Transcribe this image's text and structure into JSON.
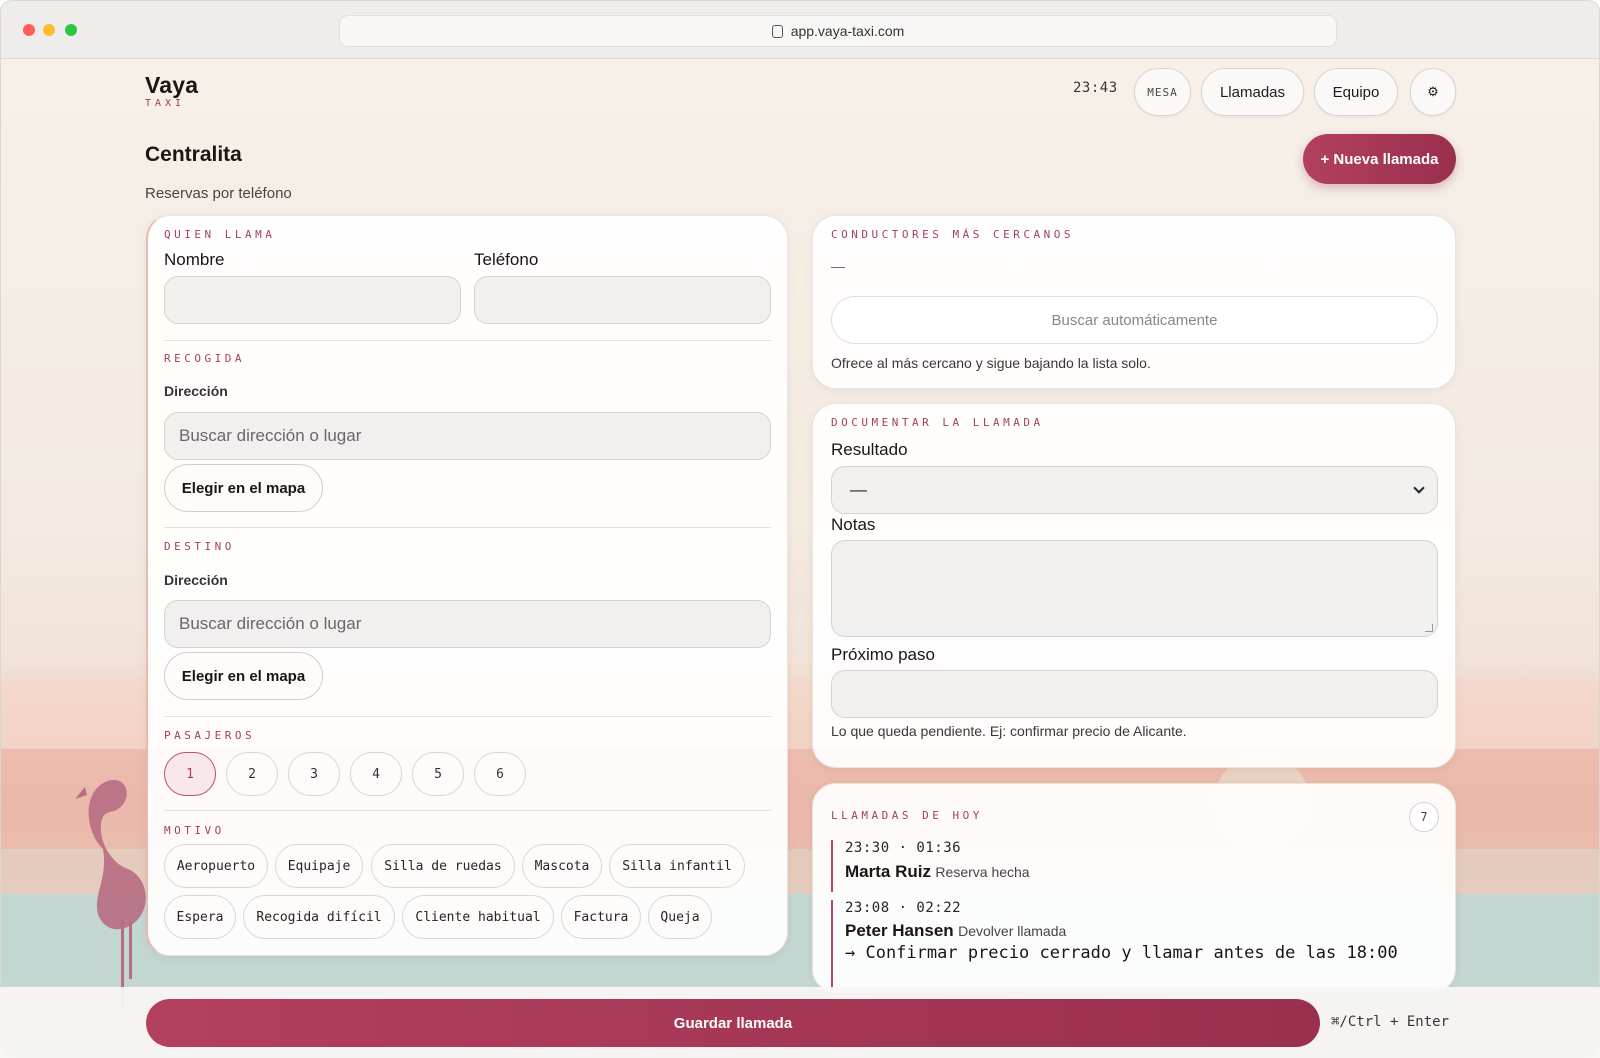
{
  "browser": {
    "url": "app.vaya-taxi.com"
  },
  "header": {
    "logo": "Vaya",
    "logo_sub": "TAXI",
    "clock": "23:43",
    "mesa_label": "MESA",
    "llamadas_label": "Llamadas",
    "equipo_label": "Equipo",
    "settings_icon": "⚙"
  },
  "page": {
    "title": "Centralita",
    "subtitle": "Reservas por teléfono",
    "new_call_label": "+ Nueva llamada"
  },
  "caller": {
    "section": "QUIEN LLAMA",
    "name_label": "Nombre",
    "name_value": "",
    "phone_label": "Teléfono",
    "phone_value": ""
  },
  "pickup": {
    "section": "RECOGIDA",
    "address_label": "Dirección",
    "placeholder": "Buscar dirección o lugar",
    "map_button": "Elegir en el mapa"
  },
  "destination": {
    "section": "DESTINO",
    "address_label": "Dirección",
    "placeholder": "Buscar dirección o lugar",
    "map_button": "Elegir en el mapa"
  },
  "passengers": {
    "section": "PASAJEROS",
    "options": [
      "1",
      "2",
      "3",
      "4",
      "5",
      "6"
    ],
    "selected": "1"
  },
  "reason": {
    "section": "MOTIVO",
    "chips": [
      "Aeropuerto",
      "Equipaje",
      "Silla de ruedas",
      "Mascota",
      "Silla infantil",
      "Espera",
      "Recogida difícil",
      "Cliente habitual",
      "Factura",
      "Queja"
    ]
  },
  "drivers": {
    "section": "CONDUCTORES MÁS CERCANOS",
    "empty": "—",
    "auto_button": "Buscar automáticamente",
    "helper": "Ofrece al más cercano y sigue bajando la lista solo."
  },
  "document": {
    "section": "DOCUMENTAR LA LLAMADA",
    "result_label": "Resultado",
    "result_value": "—",
    "notes_label": "Notas",
    "notes_value": "",
    "next_label": "Próximo paso",
    "next_value": "",
    "helper": "Lo que queda pendiente. Ej: confirmar precio de Alicante."
  },
  "today": {
    "section": "LLAMADAS DE HOY",
    "count": "7",
    "calls": [
      {
        "time": "23:30 · 01:36",
        "name": "Marta Ruiz",
        "status": "Reserva hecha",
        "next": ""
      },
      {
        "time": "23:08 · 02:22",
        "name": "Peter Hansen",
        "status": "Devolver llamada",
        "next": "→ Confirmar precio cerrado y llamar antes de las 18:00"
      }
    ]
  },
  "footer": {
    "save_label": "Guardar llamada",
    "shortcut": "⌘/Ctrl + Enter"
  },
  "colors": {
    "accent": "#a3405a",
    "button_gradient_start": "#b2405e",
    "button_gradient_end": "#9a2f4e"
  }
}
